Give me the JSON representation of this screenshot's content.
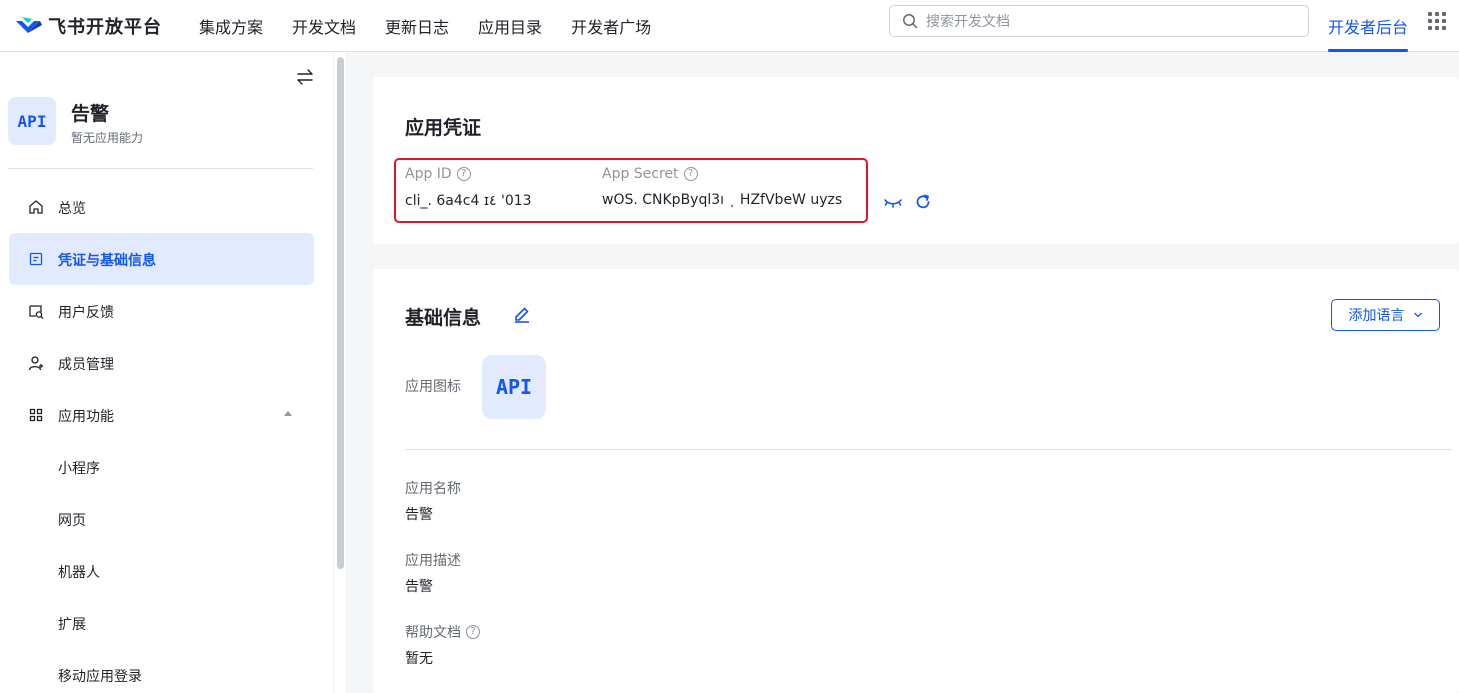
{
  "brand": {
    "name": "飞书开放平台",
    "accent": "#1456f0"
  },
  "nav": {
    "links": [
      "集成方案",
      "开发文档",
      "更新日志",
      "应用目录",
      "开发者广场"
    ],
    "search_placeholder": "搜索开发文档",
    "dev_console": "开发者后台"
  },
  "sidebar": {
    "app_logo_text": "API",
    "app_name": "告警",
    "app_subtitle": "暂无应用能力",
    "items": [
      {
        "label": "总览",
        "icon": "home-icon"
      },
      {
        "label": "凭证与基础信息",
        "icon": "credential-icon",
        "active": true
      },
      {
        "label": "用户反馈",
        "icon": "feedback-icon"
      },
      {
        "label": "成员管理",
        "icon": "user-add-icon"
      },
      {
        "label": "应用功能",
        "icon": "grid-icon",
        "expanded": true
      },
      {
        "label": "小程序"
      },
      {
        "label": "网页"
      },
      {
        "label": "机器人"
      },
      {
        "label": "扩展"
      },
      {
        "label": "移动应用登录"
      }
    ]
  },
  "credentials": {
    "title": "应用凭证",
    "app_id_label": "App ID",
    "app_id_value": "cli_.    6a4c4 ɪ٤  '013",
    "app_secret_label": "App Secret",
    "app_secret_value": "wOS.  CNKpByql3ı  ͺ  HZfVbeW    uyzs"
  },
  "basic_info": {
    "title": "基础信息",
    "add_language": "添加语言",
    "icon_label": "应用图标",
    "icon_text": "API",
    "name_label": "应用名称",
    "name_value": "告警",
    "desc_label": "应用描述",
    "desc_value": "告警",
    "help_label": "帮助文档",
    "help_value": "暂无"
  }
}
